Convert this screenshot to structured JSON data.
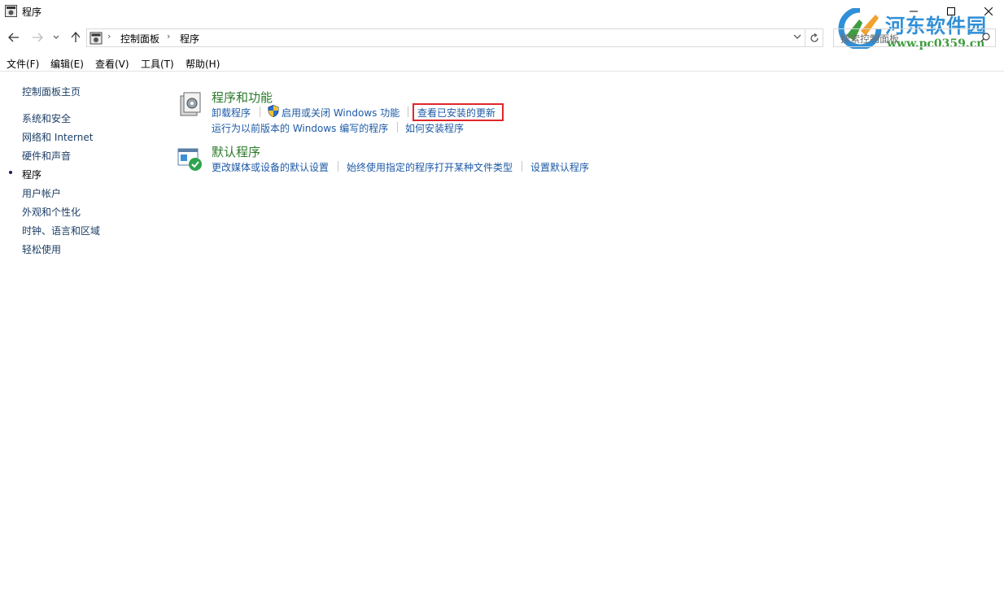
{
  "window": {
    "title": "程序",
    "controls": [
      "minimize",
      "maximize",
      "close"
    ]
  },
  "address_bar": {
    "breadcrumb": [
      "控制面板",
      "程序"
    ],
    "search_placeholder": "搜索控制面板"
  },
  "menu": {
    "items": [
      "文件(F)",
      "编辑(E)",
      "查看(V)",
      "工具(T)",
      "帮助(H)"
    ]
  },
  "sidebar": {
    "home": "控制面板主页",
    "items": [
      {
        "label": "系统和安全"
      },
      {
        "label": "网络和 Internet"
      },
      {
        "label": "硬件和声音"
      },
      {
        "label": "程序",
        "current": true
      },
      {
        "label": "用户帐户"
      },
      {
        "label": "外观和个性化"
      },
      {
        "label": "时钟、语言和区域"
      },
      {
        "label": "轻松使用"
      }
    ]
  },
  "categories": [
    {
      "title": "程序和功能",
      "icon": "programs-features-icon",
      "links": [
        "卸载程序",
        "启用或关闭 Windows 功能",
        "查看已安装的更新",
        "运行为以前版本的 Windows 编写的程序",
        "如何安装程序"
      ],
      "highlighted": "查看已安装的更新"
    },
    {
      "title": "默认程序",
      "icon": "default-programs-icon",
      "links": [
        "更改媒体或设备的默认设置",
        "始终使用指定的程序打开某种文件类型",
        "设置默认程序"
      ]
    }
  ],
  "watermark": {
    "title": "河东软件园",
    "url": "www.pc0359.cn"
  },
  "colors": {
    "link": "#1e5aa6",
    "category_title": "#2b7a2b",
    "highlight_border": "#e0262b"
  }
}
